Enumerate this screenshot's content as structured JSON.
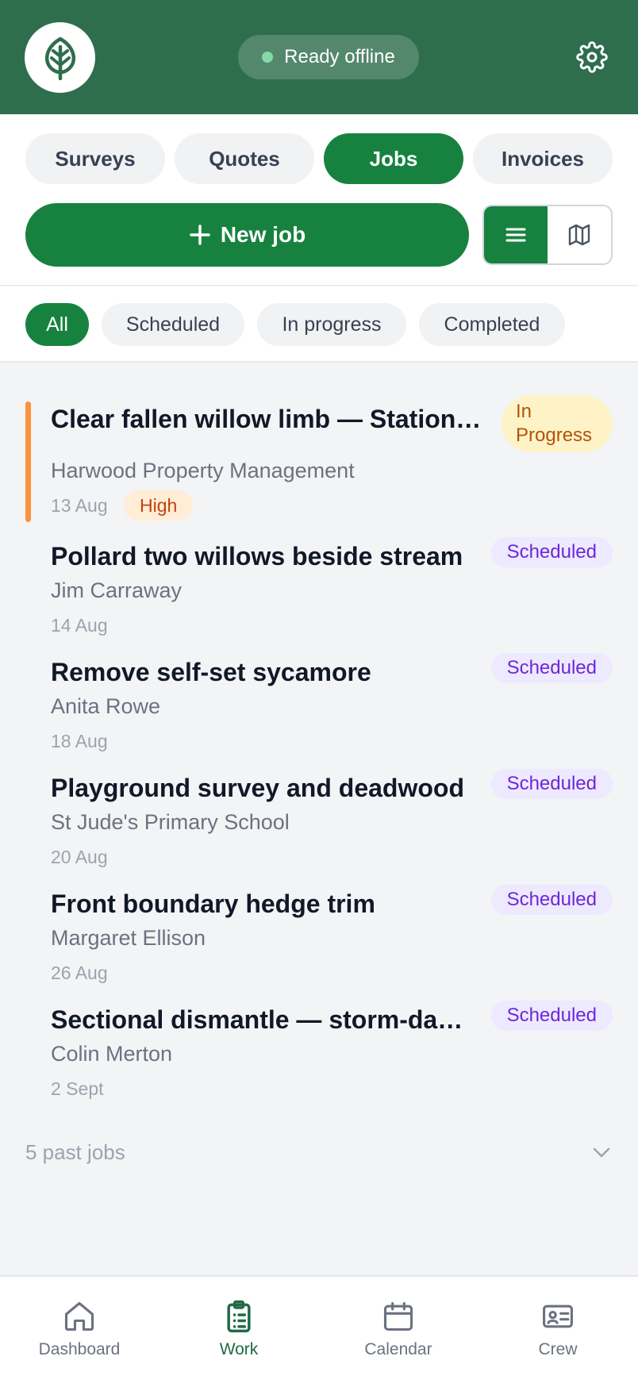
{
  "header": {
    "logo_icon": "tree-icon",
    "status_label": "Ready offline",
    "status_color": "#86d9a6",
    "settings_icon": "gear-icon",
    "brand_color": "#2f6e4d"
  },
  "sections": [
    {
      "label": "Surveys",
      "active": false
    },
    {
      "label": "Quotes",
      "active": false
    },
    {
      "label": "Jobs",
      "active": true
    },
    {
      "label": "Invoices",
      "active": false
    }
  ],
  "actions": {
    "new_job_label": "New job",
    "new_job_icon": "plus-icon",
    "view_list_icon": "list-icon",
    "view_map_icon": "map-icon"
  },
  "filters": [
    {
      "label": "All",
      "active": true
    },
    {
      "label": "Scheduled",
      "active": false
    },
    {
      "label": "In progress",
      "active": false
    },
    {
      "label": "Completed",
      "active": false
    }
  ],
  "jobs": [
    {
      "title": "Clear fallen willow limb — Station…",
      "client": "Harwood Property Management",
      "date": "13 Aug",
      "status": "In Progress",
      "priority": "High"
    },
    {
      "title": "Pollard two willows beside stream",
      "client": "Jim Carraway",
      "date": "14 Aug",
      "status": "Scheduled"
    },
    {
      "title": "Remove self-set sycamore",
      "client": "Anita Rowe",
      "date": "18 Aug",
      "status": "Scheduled"
    },
    {
      "title": "Playground survey and deadwood",
      "client": "St Jude's Primary School",
      "date": "20 Aug",
      "status": "Scheduled"
    },
    {
      "title": "Front boundary hedge trim",
      "client": "Margaret Ellison",
      "date": "26 Aug",
      "status": "Scheduled"
    },
    {
      "title": "Sectional dismantle — storm-da…",
      "client": "Colin Merton",
      "date": "2 Sept",
      "status": "Scheduled"
    }
  ],
  "past_jobs_label": "5 past jobs",
  "nav": [
    {
      "label": "Dashboard",
      "icon": "home-icon",
      "active": false
    },
    {
      "label": "Work",
      "icon": "clipboard-icon",
      "active": true
    },
    {
      "label": "Calendar",
      "icon": "calendar-icon",
      "active": false
    },
    {
      "label": "Crew",
      "icon": "id-card-icon",
      "active": false
    }
  ]
}
